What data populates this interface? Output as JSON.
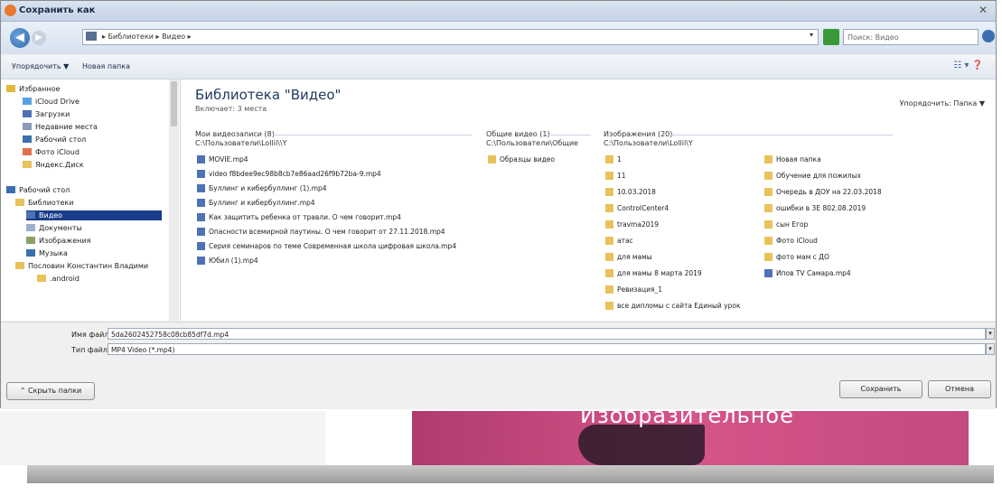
{
  "dialog": {
    "title": "Сохранить как",
    "close_label": "✕"
  },
  "address": {
    "back_icon": "back-arrow-icon",
    "breadcrumb": "▸ Библиотеки ▸ Видео ▸",
    "search_placeholder": "Поиск: Видео"
  },
  "toolbar": {
    "organize_label": "Упорядочить ▼",
    "new_folder_label": "Новая папка",
    "view_icons": "☷ ▾ ❓"
  },
  "nav": {
    "items": [
      {
        "label": "Избранное",
        "icon": "star-icon",
        "color": "#e5b93c"
      },
      {
        "label": "iCloud Drive",
        "icon": "cloud-icon",
        "color": "#5aa0e0"
      },
      {
        "label": "Загрузки",
        "icon": "downloads-icon",
        "color": "#4d72b5"
      },
      {
        "label": "Недавние места",
        "icon": "recent-icon",
        "color": "#8a9cb8"
      },
      {
        "label": "Рабочий стол",
        "icon": "desktop-icon",
        "color": "#3c6fb0"
      },
      {
        "label": "Фото iCloud",
        "icon": "photos-icon",
        "color": "#e0704a"
      },
      {
        "label": "Яндекс.Диск",
        "icon": "yadisk-icon",
        "color": "#e8c25a"
      },
      {
        "label": "Рабочий стол",
        "icon": "desktop-icon",
        "color": "#3c6fb0"
      },
      {
        "label": "Библиотеки",
        "icon": "library-icon",
        "color": "#e8c25a"
      },
      {
        "label": "Видео",
        "icon": "video-library-icon",
        "color": "#4d72b5"
      },
      {
        "label": "Документы",
        "icon": "documents-icon",
        "color": "#9ab0d0"
      },
      {
        "label": "Изображения",
        "icon": "pictures-icon",
        "color": "#8aa06a"
      },
      {
        "label": "Музыка",
        "icon": "music-icon",
        "color": "#3c6fb0"
      },
      {
        "label": "Пословин Константин Владими",
        "icon": "user-folder-icon",
        "color": "#e8c25a"
      },
      {
        "label": ".android",
        "icon": "folder-icon",
        "color": "#e8c25a"
      }
    ]
  },
  "library": {
    "title": "Библиотека \"Видео\"",
    "subtitle": "Включает: 3 места",
    "arrange_label": "Упорядочить:",
    "arrange_value": "Папка ▼"
  },
  "groups": [
    {
      "head": "Мои видеозаписи (8)",
      "path": "C:\\Пользователи\\Lollii\\\\Y",
      "files": [
        "MOVIE.mp4",
        "video f8bdee9ec98b8cb7e86aad26f9b72ba-9.mp4",
        "Буллинг и кибербуллинг (1).mp4",
        "Буллинг и кибербуллинг.mp4",
        "Как защитить ребенка от травли. О чем говорит.mp4",
        "Опасности всемирной паутины. О чем говорит от 27.11.2018.mp4",
        "Серия семинаров по теме Современная школа цифровая школа.mp4",
        "Юбил (1).mp4"
      ]
    },
    {
      "head": "Общие видео (1)",
      "path": "C:\\Пользователи\\Общие",
      "files": [
        "Образцы видео"
      ]
    },
    {
      "head": "Изображения (20)",
      "path": "C:\\Пользователи\\Lollii\\Y",
      "files": [
        "1",
        "11",
        "10.03.2018",
        "ControlCenter4",
        "travma2019",
        "атас",
        "для мамы",
        "для мамы 8 марта 2019",
        "Ревизация_1",
        "все дипломы с сайта Единый урок",
        "Новая папка",
        "Обучение для пожилых",
        "Очередь в ДОУ на 22.03.2018",
        "ошибки в 3Е 802.08.2019",
        "сын Егор",
        "Фото iCloud",
        "фото мам с ДО",
        "Ипов TV Самара.mp4"
      ]
    }
  ],
  "form": {
    "filename_label": "Имя файла:",
    "filename_value": "5da2602452758c08cb85df7d.mp4",
    "filetype_label": "Тип файла:",
    "filetype_value": "MP4 Video (*.mp4)",
    "hide_folders_label": "⌃ Скрыть папки",
    "save_label": "Сохранить",
    "cancel_label": "Отмена"
  },
  "page": {
    "heading": "Изобразительное"
  }
}
